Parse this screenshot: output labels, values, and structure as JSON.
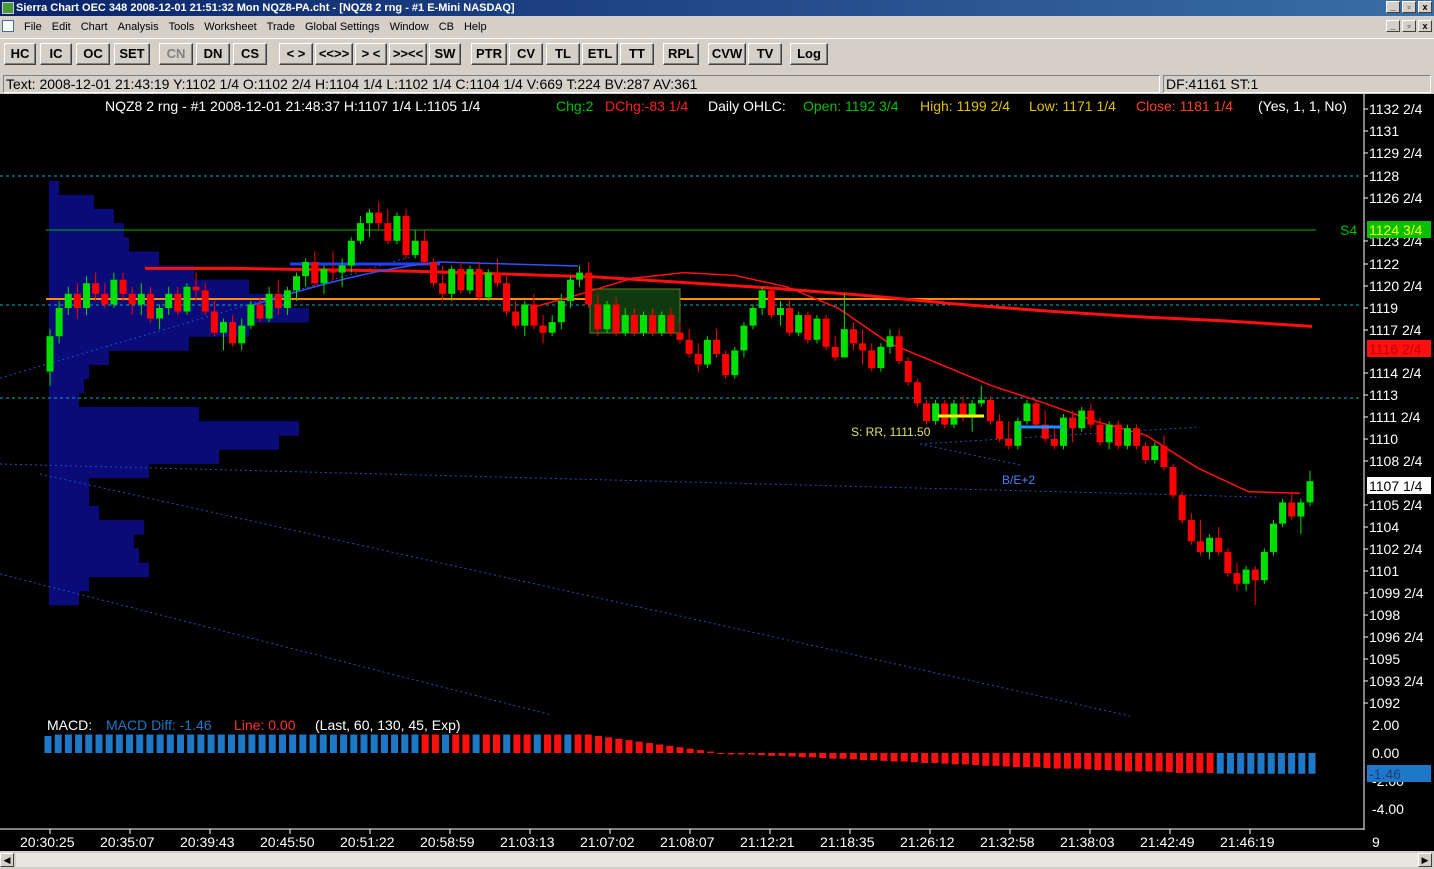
{
  "window": {
    "title": "Sierra Chart OEC 348  2008-12-01  21:51:32  Mon   NQZ8-PA.cht - [NQZ8  2 rng - #1 E-Mini NASDAQ]",
    "controls": [
      "_",
      "▫",
      "x"
    ],
    "mdi_controls": [
      "_",
      "▫",
      "x"
    ]
  },
  "menu": [
    "File",
    "Edit",
    "Chart",
    "Analysis",
    "Tools",
    "Worksheet",
    "Trade",
    "Global Settings",
    "Window",
    "CB",
    "Help"
  ],
  "toolbar": [
    "HC",
    "IC",
    "OC",
    "SET",
    "CN",
    "DN",
    "CS",
    "< >",
    "<<>>",
    "> <",
    ">><<",
    "SW",
    "PTR",
    "CV",
    "TL",
    "ETL",
    "TT",
    "RPL",
    "CVW",
    "TV",
    "Log"
  ],
  "infobar": {
    "text": "Text: 2008-12-01   21:43:19  Y:1102 1/4   O:1102 2/4   H:1104 1/4   L:1102 1/4   C:1104 1/4   V:669   T:224   BV:287   AV:361",
    "df": "DF:41161  ST:1"
  },
  "chart_header": {
    "symbol": "NQZ8  2 rng - #1  2008-12-01  21:48:37  H:1107 1/4  L:1105 1/4",
    "chg": "Chg:2",
    "dchg": "DChg:-83 1/4",
    "daily": "Daily OHLC:",
    "open": "Open: 1192 3/4",
    "high": "High: 1199 2/4",
    "low": "Low: 1171 1/4",
    "close": "Close: 1181 1/4",
    "params": "(Yes, 1, 1, No)"
  },
  "colors": {
    "up": "#00e000",
    "down": "#ff0000",
    "profile": "#0a0a78",
    "ma_red": "#ff1010",
    "ma_blue": "#2040ff",
    "orange_line": "#ff8c00",
    "s4_green": "#00c000",
    "cyan_dash": "#00b0c0",
    "macd_blue": "#1e78c8",
    "macd_red": "#ff1010"
  },
  "price_axis_labels": [
    "1132 2/4",
    "1131",
    "1129 2/4",
    "1128",
    "1126 2/4",
    "1123 2/4",
    "1122",
    "1120 2/4",
    "1119",
    "1117 2/4",
    "1114 2/4",
    "1113",
    "1111 2/4",
    "1110",
    "1108 2/4",
    "1105 2/4",
    "1104",
    "1102 2/4",
    "1101",
    "1099 2/4",
    "1098",
    "1096 2/4",
    "1095",
    "1093 2/4",
    "1092"
  ],
  "price_markers": {
    "s4_label": "S4",
    "s4_value": "1124 3/4",
    "ma_value": "1116 2/4",
    "last_value": "1107 1/4"
  },
  "annotations": {
    "rr": "S: RR, 1111.50",
    "be": "B/E+2"
  },
  "macd": {
    "title": "MACD:",
    "diff": "MACD Diff: -1.46",
    "line": "Line: 0.00",
    "params": "(Last, 60, 130, 45, Exp)",
    "axis_labels": [
      "2.00",
      "0.00",
      "-2.00",
      "-4.00"
    ],
    "current": "-1.46"
  },
  "time_axis": [
    "20:30:25",
    "20:35:07",
    "20:39:43",
    "20:45:50",
    "20:51:22",
    "20:58:59",
    "21:03:13",
    "21:07:02",
    "21:08:07",
    "21:12:21",
    "21:18:35",
    "21:26:12",
    "21:32:58",
    "21:38:03",
    "21:42:49",
    "21:46:19"
  ],
  "corner_label": "9",
  "chart_data": {
    "type": "candlestick",
    "y_range": [
      1091,
      1133.5
    ],
    "bars": [
      [
        1115,
        1118,
        1114,
        1117.5
      ],
      [
        1117.5,
        1120,
        1117,
        1119.5
      ],
      [
        1119.5,
        1121,
        1119,
        1120.5
      ],
      [
        1120.5,
        1121.25,
        1118.75,
        1119.5
      ],
      [
        1119.5,
        1121.75,
        1119,
        1121.25
      ],
      [
        1121.25,
        1122,
        1120,
        1120.5
      ],
      [
        1120.5,
        1121.25,
        1119.5,
        1119.75
      ],
      [
        1119.75,
        1122,
        1119.5,
        1121.5
      ],
      [
        1121.5,
        1122,
        1120,
        1120.5
      ],
      [
        1120.5,
        1121,
        1119,
        1119.75
      ],
      [
        1119.75,
        1121.25,
        1119,
        1120.5
      ],
      [
        1120.5,
        1121,
        1118.5,
        1118.75
      ],
      [
        1118.75,
        1119.75,
        1118,
        1119.5
      ],
      [
        1119.5,
        1121,
        1119,
        1120.5
      ],
      [
        1120.5,
        1121,
        1119,
        1119.25
      ],
      [
        1119.25,
        1121.25,
        1119,
        1121
      ],
      [
        1121,
        1122,
        1120,
        1120.75
      ],
      [
        1120.75,
        1121.25,
        1119,
        1119.25
      ],
      [
        1119.25,
        1120,
        1117.5,
        1117.75
      ],
      [
        1117.75,
        1118.75,
        1116.5,
        1118.5
      ],
      [
        1118.5,
        1119,
        1116.75,
        1117
      ],
      [
        1117,
        1118.75,
        1116.5,
        1118.25
      ],
      [
        1118.25,
        1120,
        1118,
        1119.75
      ],
      [
        1119.75,
        1120.25,
        1118.5,
        1118.75
      ],
      [
        1118.75,
        1121,
        1118.5,
        1120.5
      ],
      [
        1120.5,
        1121.5,
        1119,
        1119.5
      ],
      [
        1119.5,
        1121,
        1119,
        1120.75
      ],
      [
        1120.75,
        1122,
        1120,
        1121.75
      ],
      [
        1121.75,
        1123,
        1121,
        1122.75
      ],
      [
        1122.75,
        1123.5,
        1121,
        1121.25
      ],
      [
        1121.25,
        1122.5,
        1120.5,
        1122.25
      ],
      [
        1122.25,
        1123.5,
        1121.5,
        1122
      ],
      [
        1122,
        1123,
        1121,
        1122.5
      ],
      [
        1122.5,
        1124.5,
        1122,
        1124.25
      ],
      [
        1124.25,
        1126,
        1124,
        1125.5
      ],
      [
        1125.5,
        1126.5,
        1124.5,
        1126.25
      ],
      [
        1126.25,
        1127,
        1125,
        1125.5
      ],
      [
        1125.5,
        1126.5,
        1124,
        1124.25
      ],
      [
        1124.25,
        1126.25,
        1124,
        1126
      ],
      [
        1126,
        1126.5,
        1123,
        1123.25
      ],
      [
        1123.25,
        1125,
        1123,
        1124.25
      ],
      [
        1124.25,
        1125,
        1122.5,
        1122.75
      ],
      [
        1122.75,
        1123,
        1121,
        1121.25
      ],
      [
        1121.25,
        1122.5,
        1120,
        1120.5
      ],
      [
        1120.5,
        1122.5,
        1120,
        1122.25
      ],
      [
        1122.25,
        1122.75,
        1120.5,
        1120.75
      ],
      [
        1120.75,
        1122.5,
        1120.5,
        1122.25
      ],
      [
        1122.25,
        1122.75,
        1120,
        1120.25
      ],
      [
        1120.25,
        1122.25,
        1120,
        1122
      ],
      [
        1122,
        1123,
        1121,
        1121.25
      ],
      [
        1121.25,
        1121.75,
        1119,
        1119.25
      ],
      [
        1119.25,
        1120,
        1118,
        1118.25
      ],
      [
        1118.25,
        1120,
        1117.5,
        1119.75
      ],
      [
        1119.75,
        1120.5,
        1118,
        1118.25
      ],
      [
        1118.25,
        1119,
        1117,
        1117.75
      ],
      [
        1117.75,
        1119,
        1117.5,
        1118.5
      ],
      [
        1118.5,
        1120.5,
        1118,
        1120
      ],
      [
        1120,
        1121.75,
        1119.5,
        1121.5
      ],
      [
        1121.5,
        1122.5,
        1121,
        1122
      ],
      [
        1122,
        1122.75,
        1119.5,
        1119.75
      ],
      [
        1119.75,
        1120.5,
        1117.5,
        1118
      ],
      [
        1118,
        1120,
        1117.75,
        1119.75
      ],
      [
        1119.75,
        1120.25,
        1117.5,
        1117.75
      ],
      [
        1117.75,
        1119.5,
        1117.5,
        1119
      ],
      [
        1119,
        1119.5,
        1117.5,
        1117.75
      ],
      [
        1117.75,
        1119.25,
        1117.5,
        1119
      ],
      [
        1119,
        1119.5,
        1117.5,
        1117.75
      ],
      [
        1117.75,
        1119.25,
        1117.5,
        1119
      ],
      [
        1119,
        1119.5,
        1117.5,
        1117.75
      ],
      [
        1117.75,
        1118.5,
        1117,
        1117.25
      ],
      [
        1117.25,
        1118,
        1116,
        1116.25
      ],
      [
        1116.25,
        1117,
        1115,
        1115.5
      ],
      [
        1115.5,
        1117.5,
        1115.25,
        1117.25
      ],
      [
        1117.25,
        1118,
        1116,
        1116.25
      ],
      [
        1116.25,
        1116.5,
        1114.5,
        1114.75
      ],
      [
        1114.75,
        1116.75,
        1114.5,
        1116.5
      ],
      [
        1116.5,
        1118.5,
        1116,
        1118.25
      ],
      [
        1118.25,
        1119.75,
        1118,
        1119.5
      ],
      [
        1119.5,
        1121,
        1119,
        1120.75
      ],
      [
        1120.75,
        1121,
        1118.75,
        1119
      ],
      [
        1119,
        1120,
        1118.25,
        1119.5
      ],
      [
        1119.5,
        1120,
        1117.5,
        1117.75
      ],
      [
        1117.75,
        1119.25,
        1117.5,
        1119
      ],
      [
        1119,
        1119.25,
        1117,
        1117.25
      ],
      [
        1117.25,
        1119,
        1117,
        1118.75
      ],
      [
        1118.75,
        1119,
        1116.5,
        1116.75
      ],
      [
        1116.75,
        1117.5,
        1115.75,
        1116
      ],
      [
        1116,
        1120.5,
        1116,
        1118
      ],
      [
        1118,
        1118.5,
        1116.5,
        1117
      ],
      [
        1117,
        1118,
        1115.5,
        1116.5
      ],
      [
        1116.5,
        1117,
        1115,
        1115.25
      ],
      [
        1115.25,
        1117,
        1115,
        1116.75
      ],
      [
        1116.75,
        1118,
        1116.25,
        1117.5
      ],
      [
        1117.5,
        1118,
        1115.5,
        1115.75
      ],
      [
        1115.75,
        1116,
        1114,
        1114.25
      ],
      [
        1114.25,
        1114.5,
        1112.5,
        1112.75
      ],
      [
        1112.75,
        1113,
        1111.25,
        1111.5
      ],
      [
        1111.5,
        1113,
        1111.25,
        1112.75
      ],
      [
        1112.75,
        1113,
        1111,
        1111.25
      ],
      [
        1111.25,
        1113,
        1111,
        1112.75
      ],
      [
        1112.75,
        1113.25,
        1111.5,
        1111.75
      ],
      [
        1111.75,
        1113,
        1110.75,
        1112.75
      ],
      [
        1112.75,
        1114,
        1112.5,
        1113
      ],
      [
        1113,
        1113.25,
        1111.25,
        1111.5
      ],
      [
        1111.5,
        1112,
        1110,
        1110.25
      ],
      [
        1110.25,
        1111.5,
        1109.5,
        1109.75
      ],
      [
        1109.75,
        1111.75,
        1109.5,
        1111.5
      ],
      [
        1111.5,
        1113,
        1111.25,
        1112.75
      ],
      [
        1112.75,
        1113,
        1111,
        1111.25
      ],
      [
        1111.25,
        1112.25,
        1110,
        1110.25
      ],
      [
        1110.25,
        1111,
        1109.5,
        1109.75
      ],
      [
        1109.75,
        1112,
        1109.5,
        1111.75
      ],
      [
        1111.75,
        1112.25,
        1110,
        1111
      ],
      [
        1111,
        1112.5,
        1110.75,
        1112.25
      ],
      [
        1112.25,
        1112.75,
        1111,
        1111.25
      ],
      [
        1111.25,
        1111.75,
        1109.75,
        1110
      ],
      [
        1110,
        1111.5,
        1109.5,
        1111.25
      ],
      [
        1111.25,
        1111.5,
        1109.5,
        1109.75
      ],
      [
        1109.75,
        1111.25,
        1109.5,
        1111
      ],
      [
        1111,
        1111.25,
        1109.5,
        1109.75
      ],
      [
        1109.75,
        1110,
        1108.5,
        1108.75
      ],
      [
        1108.75,
        1110,
        1108.5,
        1109.75
      ],
      [
        1109.75,
        1110.5,
        1108,
        1108.25
      ],
      [
        1108.25,
        1108.5,
        1106,
        1106.25
      ],
      [
        1106.25,
        1106.5,
        1104.25,
        1104.5
      ],
      [
        1104.5,
        1105,
        1102.75,
        1103
      ],
      [
        1103,
        1104.5,
        1102,
        1102.25
      ],
      [
        1102.25,
        1103.5,
        1101.75,
        1103.25
      ],
      [
        1103.25,
        1104,
        1102,
        1102.25
      ],
      [
        1102.25,
        1102.5,
        1100.5,
        1100.75
      ],
      [
        1100.75,
        1101.5,
        1099.5,
        1100
      ],
      [
        1100,
        1101.25,
        1099.5,
        1101
      ],
      [
        1101,
        1101.25,
        1098.5,
        1100.25
      ],
      [
        1100.25,
        1102.5,
        1100,
        1102.25
      ],
      [
        1102.25,
        1104.5,
        1102,
        1104.25
      ],
      [
        1104.25,
        1106,
        1104,
        1105.75
      ],
      [
        1105.75,
        1106.5,
        1104.5,
        1104.75
      ],
      [
        1104.75,
        1106,
        1103.5,
        1105.75
      ],
      [
        1105.75,
        1108,
        1105.5,
        1107.25
      ]
    ],
    "profile": [
      [
        1128,
        10
      ],
      [
        1127,
        45
      ],
      [
        1126,
        65
      ],
      [
        1125,
        75
      ],
      [
        1124,
        80
      ],
      [
        1123,
        110
      ],
      [
        1122,
        145
      ],
      [
        1121,
        200
      ],
      [
        1120,
        240
      ],
      [
        1119,
        260
      ],
      [
        1118,
        200
      ],
      [
        1117,
        140
      ],
      [
        1116,
        60
      ],
      [
        1115,
        40
      ],
      [
        1114,
        35
      ],
      [
        1113,
        30
      ],
      [
        1112,
        150
      ],
      [
        1111,
        250
      ],
      [
        1110,
        230
      ],
      [
        1109,
        170
      ],
      [
        1108,
        100
      ],
      [
        1107,
        40
      ],
      [
        1106,
        40
      ],
      [
        1105,
        50
      ],
      [
        1104,
        95
      ],
      [
        1103,
        85
      ],
      [
        1102,
        90
      ],
      [
        1101,
        100
      ],
      [
        1100,
        40
      ],
      [
        1099,
        30
      ]
    ],
    "ma_slow": [
      1122.3,
      1122.3,
      1122.2,
      1122.1,
      1121.9,
      1121.7,
      1121.3,
      1120.9,
      1120.4,
      1119.8,
      1119.3,
      1118.9,
      1118.6,
      1118.2
    ],
    "ma_fast": [
      1119.5,
      1120.5,
      1121.6,
      1122,
      1121.8,
      1121,
      1119.5,
      1117,
      1115.5,
      1114,
      1112.8,
      1111.5,
      1110.5,
      1108.2,
      1106.5,
      1106.4
    ],
    "macd_hist": [
      1.2,
      1.3,
      1.3,
      1.3,
      1.3,
      1.3,
      1.3,
      1.3,
      1.3,
      1.3,
      1.3,
      1.3,
      1.3,
      1.3,
      1.3,
      1.3,
      1.3,
      1.3,
      1.3,
      1.3,
      1.3,
      1.3,
      1.3,
      1.3,
      1.3,
      1.3,
      1.3,
      1.3,
      1.3,
      1.3,
      1.3,
      1.3,
      1.3,
      1.3,
      1.3,
      1.3,
      1.3,
      1.3,
      1.3,
      1.3,
      1.3,
      1.3,
      1.3,
      1.3,
      1.3,
      1.3,
      1.3,
      1.3,
      1.3,
      1.3,
      1.3,
      1.3,
      1.3,
      1.3,
      1.2,
      1.1,
      1.0,
      0.9,
      0.8,
      0.7,
      0.6,
      0.5,
      0.4,
      0.3,
      0.2,
      0.1,
      0.0,
      -0.1,
      -0.1,
      -0.1,
      -0.15,
      -0.2,
      -0.2,
      -0.25,
      -0.3,
      -0.3,
      -0.35,
      -0.4,
      -0.4,
      -0.45,
      -0.5,
      -0.5,
      -0.55,
      -0.6,
      -0.6,
      -0.65,
      -0.7,
      -0.7,
      -0.75,
      -0.8,
      -0.8,
      -0.85,
      -0.9,
      -0.9,
      -0.95,
      -1.0,
      -1.0,
      -1.0,
      -1.05,
      -1.1,
      -1.1,
      -1.1,
      -1.15,
      -1.2,
      -1.2,
      -1.25,
      -1.3,
      -1.3,
      -1.3,
      -1.3,
      -1.35,
      -1.4,
      -1.4,
      -1.4,
      -1.4,
      -1.45,
      -1.45,
      -1.46,
      -1.46,
      -1.46,
      -1.46,
      -1.46,
      -1.46,
      -1.46,
      -1.46
    ]
  }
}
